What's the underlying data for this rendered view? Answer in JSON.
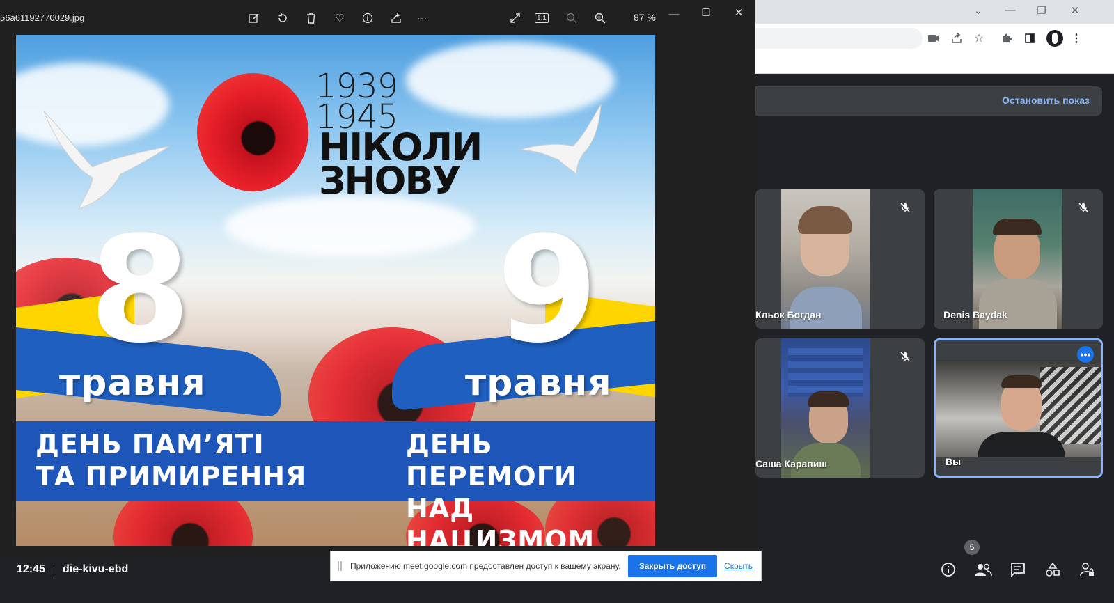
{
  "photos_viewer": {
    "file_name": "56a61192770029.jpg",
    "toolbar": {
      "edit_icon": "edit-image-icon",
      "rotate_icon": "rotate-icon",
      "delete_icon": "trash-icon",
      "favorite_icon": "heart-icon",
      "info_icon": "info-icon",
      "share_icon": "share-icon",
      "more_label": "···",
      "fullscreen_icon": "expand-icon",
      "actual_size_label": "1:1",
      "zoom_out_icon": "zoom-out-icon",
      "zoom_in_icon": "zoom-in-icon",
      "zoom_level": "87 %"
    },
    "window_controls": {
      "minimize": "—",
      "maximize": "☐",
      "close": "✕"
    }
  },
  "poster": {
    "years_top": "1939",
    "years_bottom": "1945",
    "slogan_line1": "НІКОЛИ",
    "slogan_line2": "ЗНОВУ",
    "left_day": "8",
    "right_day": "9",
    "left_month": "травня",
    "right_month": "травня",
    "left_caption_line1": "ДЕНЬ ПАМ’ЯТІ",
    "left_caption_line2": "ТА ПРИМИРЕННЯ",
    "right_caption_line1": "ДЕНЬ ПЕРЕМОГИ",
    "right_caption_line2": "НАД НАЦИЗМОМ",
    "colors": {
      "ribbon_blue": "#1f5fbf",
      "flag_yellow": "#ffd500",
      "poppy_red": "#e8202a",
      "band_blue": "#1d56b8"
    }
  },
  "chrome": {
    "window_controls": {
      "tab_search": "⌄",
      "minimize": "—",
      "restore": "❐",
      "close": "✕"
    },
    "toolbar_icons": [
      "camera-icon",
      "share-icon",
      "star-icon",
      "extensions-icon",
      "sidepanel-icon",
      "profile-icon",
      "menu-icon"
    ]
  },
  "meet": {
    "stop_presenting_label": "Остановить показ",
    "participants": [
      {
        "name": "Кльок Богдан",
        "muted": true
      },
      {
        "name": "Denis Baydak",
        "muted": true
      },
      {
        "name": "Саша Карапиш",
        "muted": true
      },
      {
        "name": "Вы",
        "muted": false,
        "speaking": true
      }
    ],
    "time": "12:45",
    "meeting_code": "die-kivu-ebd",
    "people_count": "5",
    "bottom_icons": [
      "info-icon",
      "people-icon",
      "chat-icon",
      "activities-icon",
      "host-controls-icon"
    ]
  },
  "share_notice": {
    "text": "Приложению meet.google.com предоставлен доступ к вашему экрану.",
    "stop_label": "Закрыть доступ",
    "hide_label": "Скрыть"
  }
}
